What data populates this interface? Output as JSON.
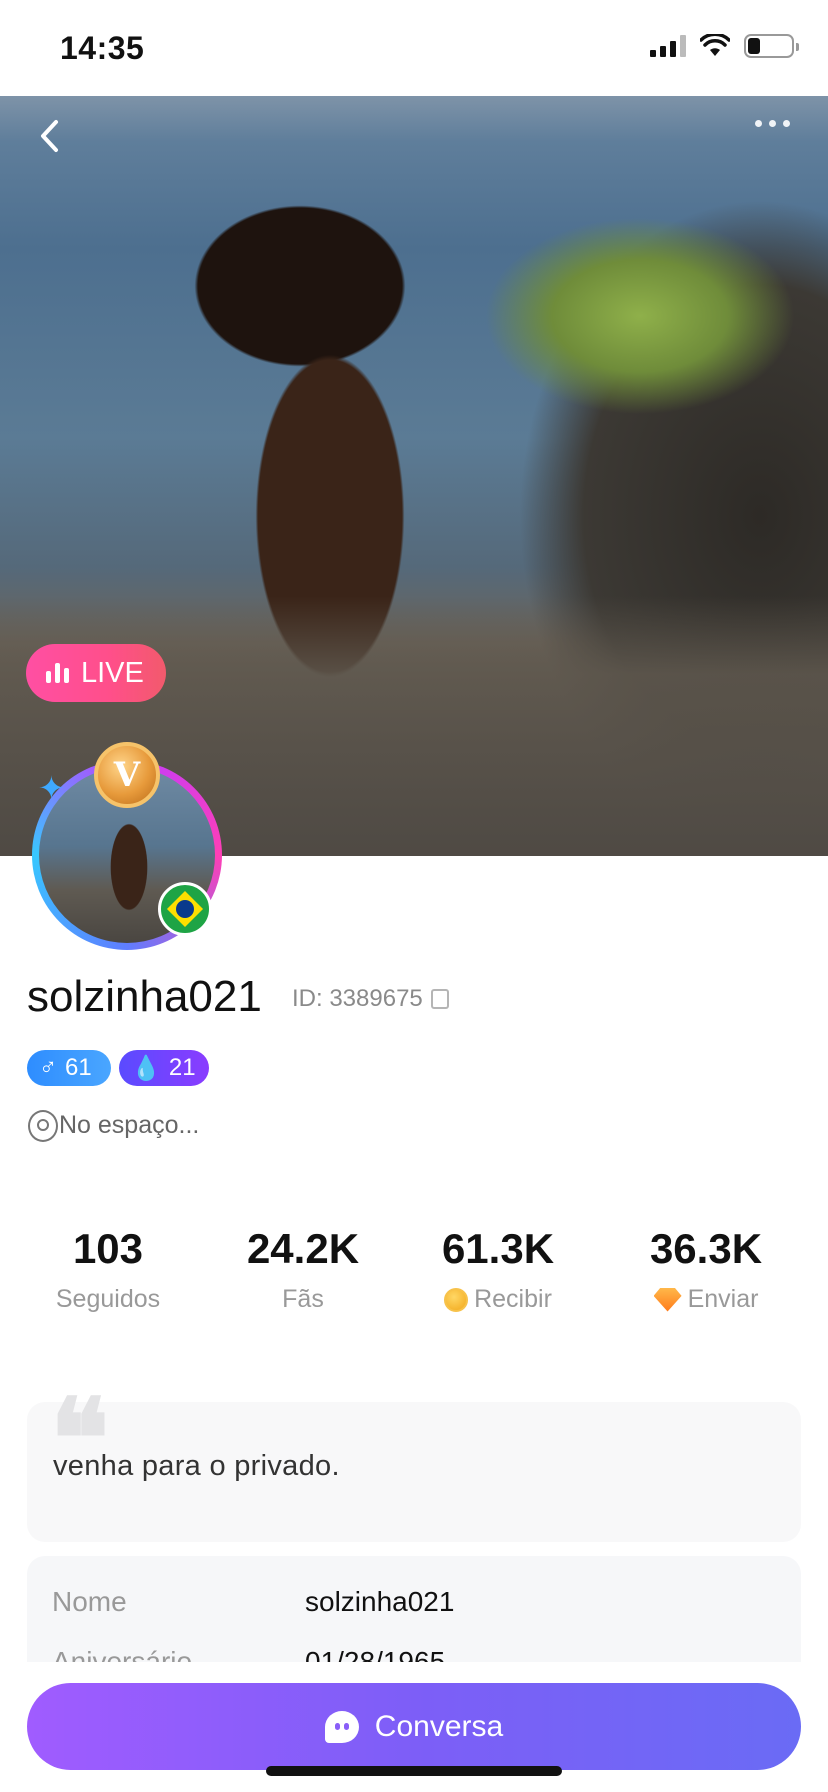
{
  "status_bar": {
    "time": "14:35"
  },
  "hero": {
    "live_label": "LIVE"
  },
  "avatar": {
    "vip_letter": "V"
  },
  "profile": {
    "username": "solzinha021",
    "id_text": "ID: 3389675",
    "male_badge": "61",
    "level_badge": "21",
    "location": "No espaço..."
  },
  "stats": [
    {
      "value": "103",
      "label": "Seguidos"
    },
    {
      "value": "24.2K",
      "label": "Fãs"
    },
    {
      "value": "61.3K",
      "label": "Recibir"
    },
    {
      "value": "36.3K",
      "label": "Enviar"
    }
  ],
  "bio": {
    "quote_mark": "❝",
    "text": "venha para o privado."
  },
  "details": [
    {
      "label": "Nome",
      "value": "solzinha021"
    },
    {
      "label": "Aniversário",
      "value": "01/28/1965"
    }
  ],
  "chat_button": {
    "label": "Conversa"
  },
  "colors": {
    "accent": "#7d5ef7",
    "live": "#ff4f8a"
  }
}
